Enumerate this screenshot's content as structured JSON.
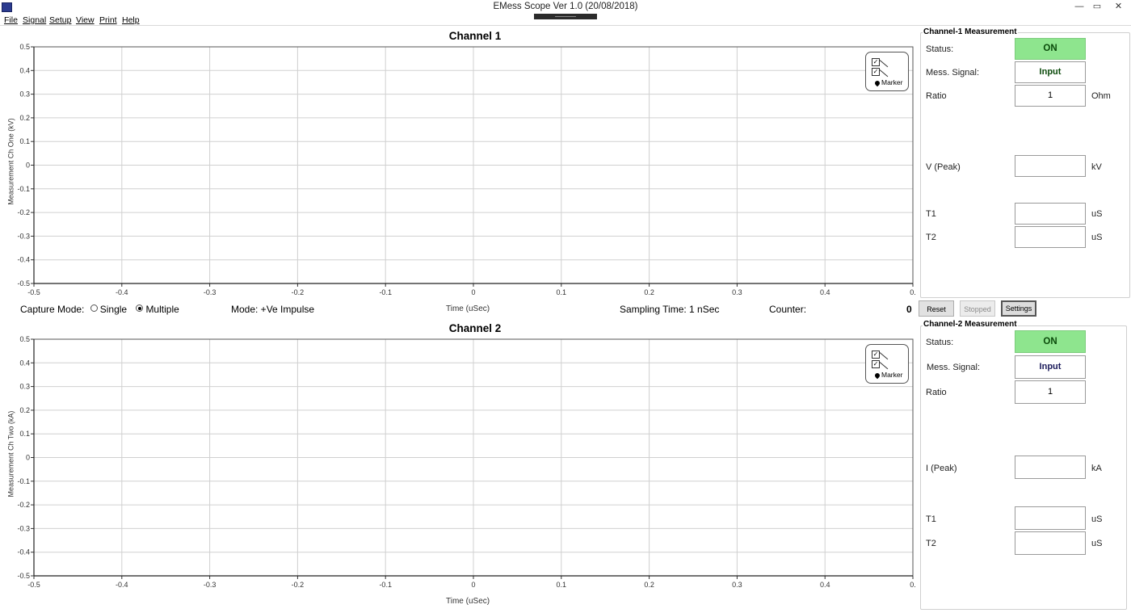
{
  "window": {
    "title": "EMess Scope Ver 1.0 (20/08/2018)",
    "minimize_glyph": "—",
    "maximize_glyph": "▭",
    "close_glyph": "✕"
  },
  "menu": [
    {
      "label": "File"
    },
    {
      "label": "Signal"
    },
    {
      "label": "Setup"
    },
    {
      "label": "View"
    },
    {
      "label": "Print"
    },
    {
      "label": "Help"
    }
  ],
  "channel1_chart": {
    "title": "Channel 1",
    "xlabel": "Time (uSec)",
    "ylabel": "Measurement Ch One (kV)"
  },
  "channel2_chart": {
    "title": "Channel 2",
    "xlabel": "Time (uSec)",
    "ylabel": "Measurement Ch Two (kA)"
  },
  "legend": {
    "marker_label": "Marker"
  },
  "chart_data": [
    {
      "type": "line",
      "title": "Channel 1",
      "xlabel": "Time (uSec)",
      "ylabel": "Measurement Ch One (kV)",
      "xlim": [
        -0.5,
        0.5
      ],
      "ylim": [
        -0.5,
        0.5
      ],
      "x_ticks": [
        "-0.5",
        "-0.4",
        "-0.3",
        "-0.2",
        "-0.1",
        "0",
        "0.1",
        "0.2",
        "0.3",
        "0.4",
        "0."
      ],
      "y_ticks": [
        "0.5",
        "0.4",
        "0.3",
        "0.2",
        "0.1",
        "0",
        "-0.1",
        "-0.2",
        "-0.3",
        "-0.4",
        "-0.5"
      ],
      "series": [],
      "grid": true,
      "legend": "top-right"
    },
    {
      "type": "line",
      "title": "Channel 2",
      "xlabel": "Time (uSec)",
      "ylabel": "Measurement Ch Two (kA)",
      "xlim": [
        -0.5,
        0.5
      ],
      "ylim": [
        -0.5,
        0.5
      ],
      "x_ticks": [
        "-0.5",
        "-0.4",
        "-0.3",
        "-0.2",
        "-0.1",
        "0",
        "0.1",
        "0.2",
        "0.3",
        "0.4",
        "0."
      ],
      "y_ticks": [
        "0.5",
        "0.4",
        "0.3",
        "0.2",
        "0.1",
        "0",
        "-0.1",
        "-0.2",
        "-0.3",
        "-0.4",
        "-0.5"
      ],
      "series": [],
      "grid": true,
      "legend": "top-right"
    }
  ],
  "status": {
    "capture_mode_label": "Capture Mode:",
    "single_label": "Single",
    "multiple_label": "Multiple",
    "selected_capture_mode": "Multiple",
    "mode_text": "Mode: +Ve Impulse",
    "sampling_text": "Sampling Time: 1 nSec",
    "counter_label": "Counter:",
    "counter_value": "0"
  },
  "controls": {
    "reset": "Reset",
    "stopped": "Stopped",
    "settings": "Settings"
  },
  "ch1_panel": {
    "title": "Channel-1 Measurement",
    "status_label": "Status:",
    "status_value": "ON",
    "signal_label": "Mess. Signal:",
    "signal_value": "Input",
    "ratio_label": "Ratio",
    "ratio_value": "1",
    "ratio_unit": "Ohm",
    "peak_label": "V (Peak)",
    "peak_value": "",
    "peak_unit": "kV",
    "t1_label": "T1",
    "t1_value": "",
    "t1_unit": "uS",
    "t2_label": "T2",
    "t2_value": "",
    "t2_unit": "uS"
  },
  "ch2_panel": {
    "title": "Channel-2 Measurement",
    "status_label": "Status:",
    "status_value": "ON",
    "signal_label": "Mess. Signal:",
    "signal_value": "Input",
    "ratio_label": "Ratio",
    "ratio_value": "1",
    "peak_label": "I (Peak)",
    "peak_value": "",
    "peak_unit": "kA",
    "t1_label": "T1",
    "t1_value": "",
    "t1_unit": "uS",
    "t2_label": "T2",
    "t2_value": "",
    "t2_unit": "uS"
  },
  "colors": {
    "status_on": "#8ee58e",
    "signal_ch1": "#0a4a0a",
    "signal_ch2": "#1a1a5a",
    "grid": "#d0d0d0",
    "app_icon": "#2b3b8f"
  }
}
